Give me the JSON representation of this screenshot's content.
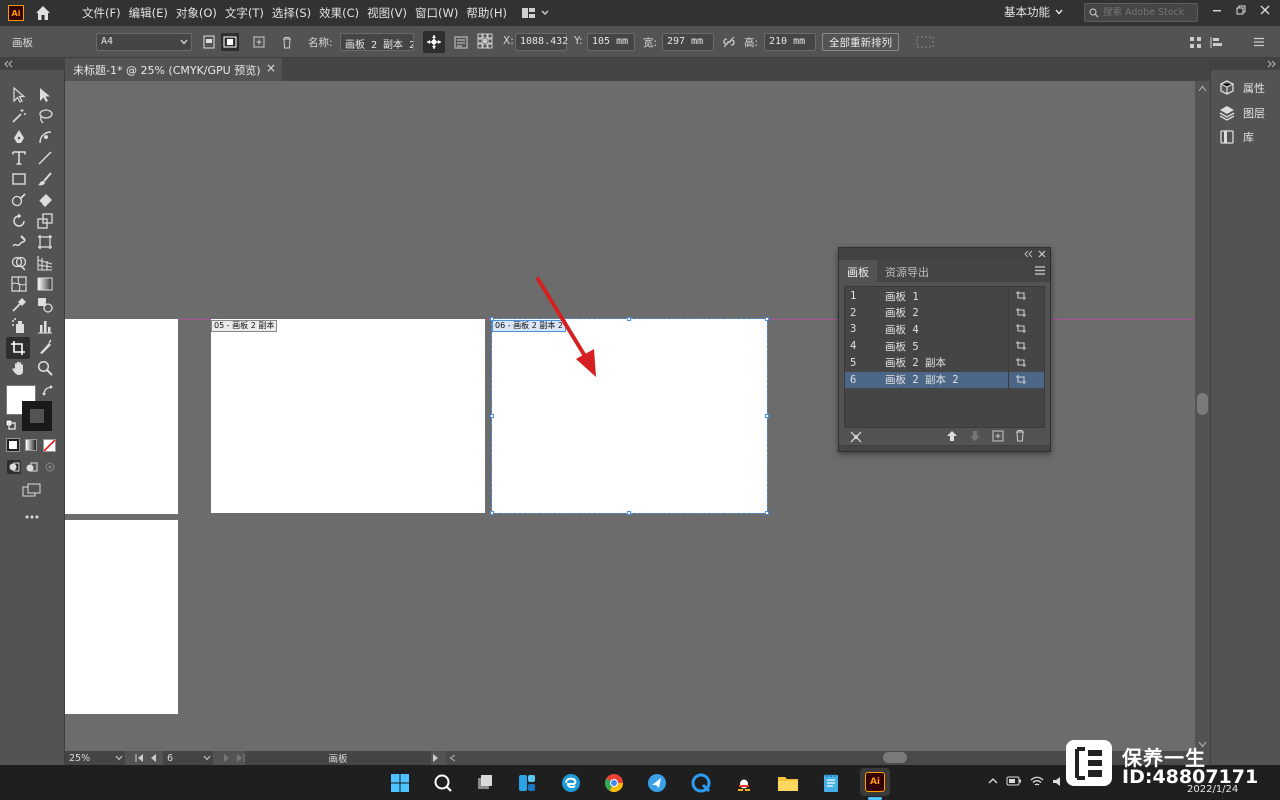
{
  "app": {
    "logo_text": "Ai",
    "menu": [
      "文件(F)",
      "编辑(E)",
      "对象(O)",
      "文字(T)",
      "选择(S)",
      "效果(C)",
      "视图(V)",
      "窗口(W)",
      "帮助(H)"
    ],
    "workspace": "基本功能",
    "stock_search_placeholder": "搜索 Adobe Stock"
  },
  "controlbar": {
    "mode_label": "画板",
    "preset": "A4",
    "name_label": "名称:",
    "name_value": "画板 2 副本 2",
    "x_label": "X:",
    "x_value": "1088.432",
    "y_label": "Y:",
    "y_value": "105 mm",
    "w_label": "宽:",
    "w_value": "297 mm",
    "h_label": "高:",
    "h_value": "210 mm",
    "rearrange_label": "全部重新排列"
  },
  "document": {
    "tab_title": "未标题-1* @ 25% (CMYK/GPU 预览)",
    "close_glyph": "×"
  },
  "canvas": {
    "artboard_labels": [
      "05 - 画板 2 副本",
      "06 - 画板 2 副本 2"
    ]
  },
  "right_panel": {
    "items": [
      "属性",
      "图层",
      "库"
    ]
  },
  "artboards_panel": {
    "tabs": [
      "画板",
      "资源导出"
    ],
    "rows": [
      {
        "num": "1",
        "name": "画板 1",
        "selected": false
      },
      {
        "num": "2",
        "name": "画板 2",
        "selected": false
      },
      {
        "num": "3",
        "name": "画板 4",
        "selected": false
      },
      {
        "num": "4",
        "name": "画板 5",
        "selected": false
      },
      {
        "num": "5",
        "name": "画板 2 副本",
        "selected": false
      },
      {
        "num": "6",
        "name": "画板 2 副本 2",
        "selected": true
      }
    ]
  },
  "statusbar": {
    "zoom": "25%",
    "artboard_number": "6",
    "tool_name": "画板"
  },
  "taskbar": {
    "date": "2022/1/24",
    "active_app_label": "Ai"
  },
  "watermark": {
    "name": "保养一生",
    "id": "ID:48807171"
  },
  "colors": {
    "accent_orange": "#ff9a00",
    "selection_blue": "#4b6687",
    "guide_magenta": "#c84ab2",
    "arrow_red": "#d42020"
  }
}
